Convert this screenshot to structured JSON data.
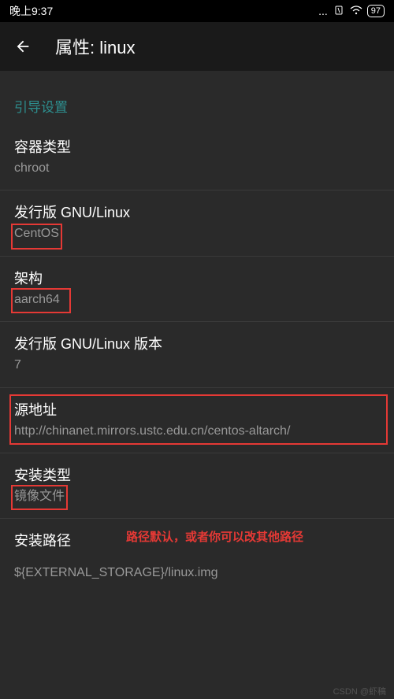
{
  "statusBar": {
    "time": "晚上9:37",
    "dots": "...",
    "battery": "97"
  },
  "header": {
    "title": "属性: linux"
  },
  "sectionHeader": "引导设置",
  "settings": {
    "containerType": {
      "label": "容器类型",
      "value": "chroot"
    },
    "distro": {
      "label": "发行版 GNU/Linux",
      "value": "CentOS"
    },
    "arch": {
      "label": "架构",
      "value": "aarch64"
    },
    "distroVersion": {
      "label": "发行版 GNU/Linux 版本",
      "value": "7"
    },
    "sourceUrl": {
      "label": "源地址",
      "value": "http://chinanet.mirrors.ustc.edu.cn/centos-altarch/"
    },
    "installType": {
      "label": "安装类型",
      "value": "镜像文件"
    },
    "installPath": {
      "label": "安装路径",
      "value": "${EXTERNAL_STORAGE}/linux.img"
    }
  },
  "annotation": "路径默认，或者你可以改其他路径",
  "watermark": "CSDN @虾稿"
}
